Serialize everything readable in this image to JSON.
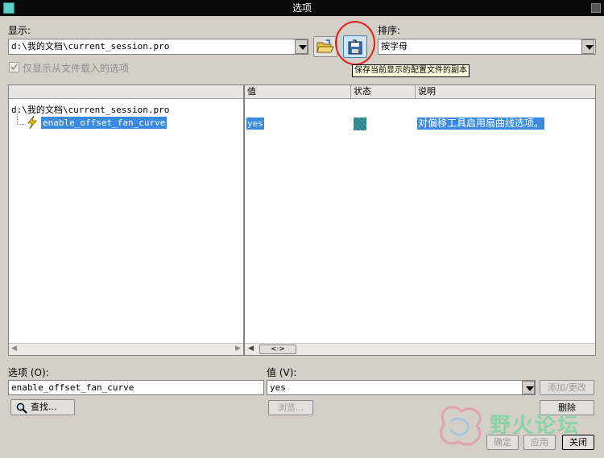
{
  "window": {
    "title": "选项"
  },
  "display": {
    "label": "显示:",
    "file_value": "d:\\我的文档\\current_session.pro",
    "checkbox_label": "仅显示从文件载入的选项",
    "checkbox_checked": true
  },
  "sort": {
    "label": "排序:",
    "value": "按字母"
  },
  "toolbar": {
    "open_icon": "folder-open-icon",
    "save_icon": "save-copy-icon",
    "save_tooltip": "保存当前显示的配置文件的副本"
  },
  "tree": {
    "root": "d:\\我的文档\\current_session.pro",
    "items": [
      {
        "label": "enable_offset_fan_curve",
        "icon": "lightning-icon"
      }
    ]
  },
  "table": {
    "columns": [
      "值",
      "状态",
      "说明"
    ],
    "rows": [
      {
        "value": "yes",
        "description": "对偏移工具启用扇曲线选项。"
      }
    ],
    "hscroll_label": "<·>"
  },
  "bottom": {
    "option_label": "选项 (O):",
    "option_value": "enable_offset_fan_curve",
    "value_label": "值 (V):",
    "value_value": "yes",
    "add_change_label": "添加/更改",
    "find_label": "查找...",
    "browse_label": "浏览...",
    "delete_label": "删除",
    "ok_label": "确定",
    "apply_label": "应用",
    "close_label": "关闭"
  },
  "watermark": {
    "text": "野火论坛"
  },
  "colors": {
    "selection": "#3a8ae0",
    "highlight_circle": "#e0201c",
    "tooltip_bg": "#ffffe1"
  }
}
